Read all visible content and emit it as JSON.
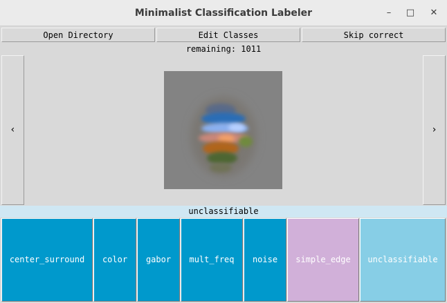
{
  "window": {
    "title": "Minimalist Classification Labeler"
  },
  "toolbar": {
    "open_directory": "Open Directory",
    "edit_classes": "Edit Classes",
    "skip_correct": "Skip correct"
  },
  "status": {
    "remaining": "remaining: 1011"
  },
  "nav": {
    "prev": "‹",
    "next": "›"
  },
  "current_label": "unclassifiable",
  "classes": [
    {
      "label": "center_surround",
      "color": "#0099cc"
    },
    {
      "label": "color",
      "color": "#0099cc"
    },
    {
      "label": "gabor",
      "color": "#0099cc"
    },
    {
      "label": "mult_freq",
      "color": "#0099cc"
    },
    {
      "label": "noise",
      "color": "#0099cc"
    },
    {
      "label": "simple_edge",
      "color": "#d1b0d9"
    },
    {
      "label": "unclassifiable",
      "color": "#87cee6"
    }
  ],
  "icons": {
    "minimize": "minimize-icon",
    "maximize": "maximize-icon",
    "close": "close-icon"
  }
}
